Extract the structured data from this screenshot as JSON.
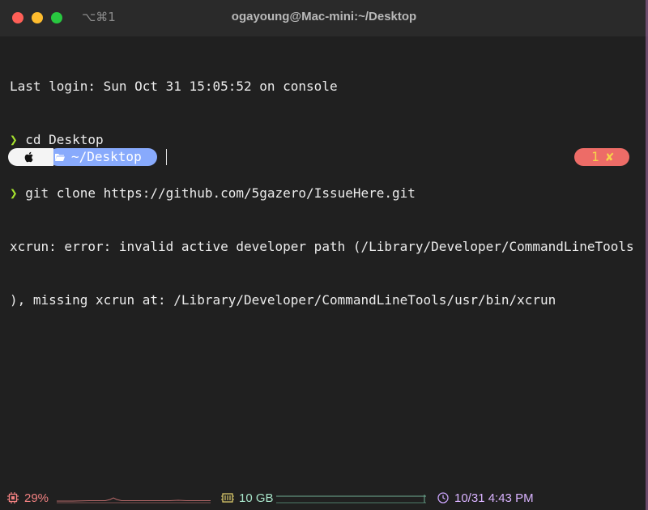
{
  "window": {
    "title": "ogayoung@Mac-mini:~/Desktop",
    "shortcut": "⌥⌘1"
  },
  "terminal": {
    "lines": [
      {
        "prompt": "",
        "text": "Last login: Sun Oct 31 15:05:52 on console"
      },
      {
        "prompt": "❯",
        "text": " cd Desktop"
      },
      {
        "prompt": "❯",
        "text": " git clone https://github.com/5gazero/IssueHere.git"
      },
      {
        "prompt": "",
        "text": "xcrun: error: invalid active developer path (/Library/Developer/CommandLineTools"
      },
      {
        "prompt": "",
        "text": "), missing xcrun at: /Library/Developer/CommandLineTools/usr/bin/xcrun"
      }
    ]
  },
  "prompt_bar": {
    "os_icon": "apple-icon",
    "folder_icon": "folder-icon",
    "path": "~/Desktop",
    "colors": {
      "os_segment": "#f4f4f4",
      "path_segment": "#88aafc"
    }
  },
  "error_badge": {
    "count": "1",
    "mark": "✘",
    "color": "#ed6c67"
  },
  "status_bar": {
    "cpu": {
      "icon": "cpu-icon",
      "label": "29%",
      "color": "#f08080"
    },
    "memory": {
      "icon": "memory-icon",
      "label": "10 GB",
      "color": "#a6e3c8"
    },
    "clock": {
      "icon": "clock-icon",
      "label": "10/31 4:43 PM",
      "color": "#d9b3ff"
    }
  }
}
